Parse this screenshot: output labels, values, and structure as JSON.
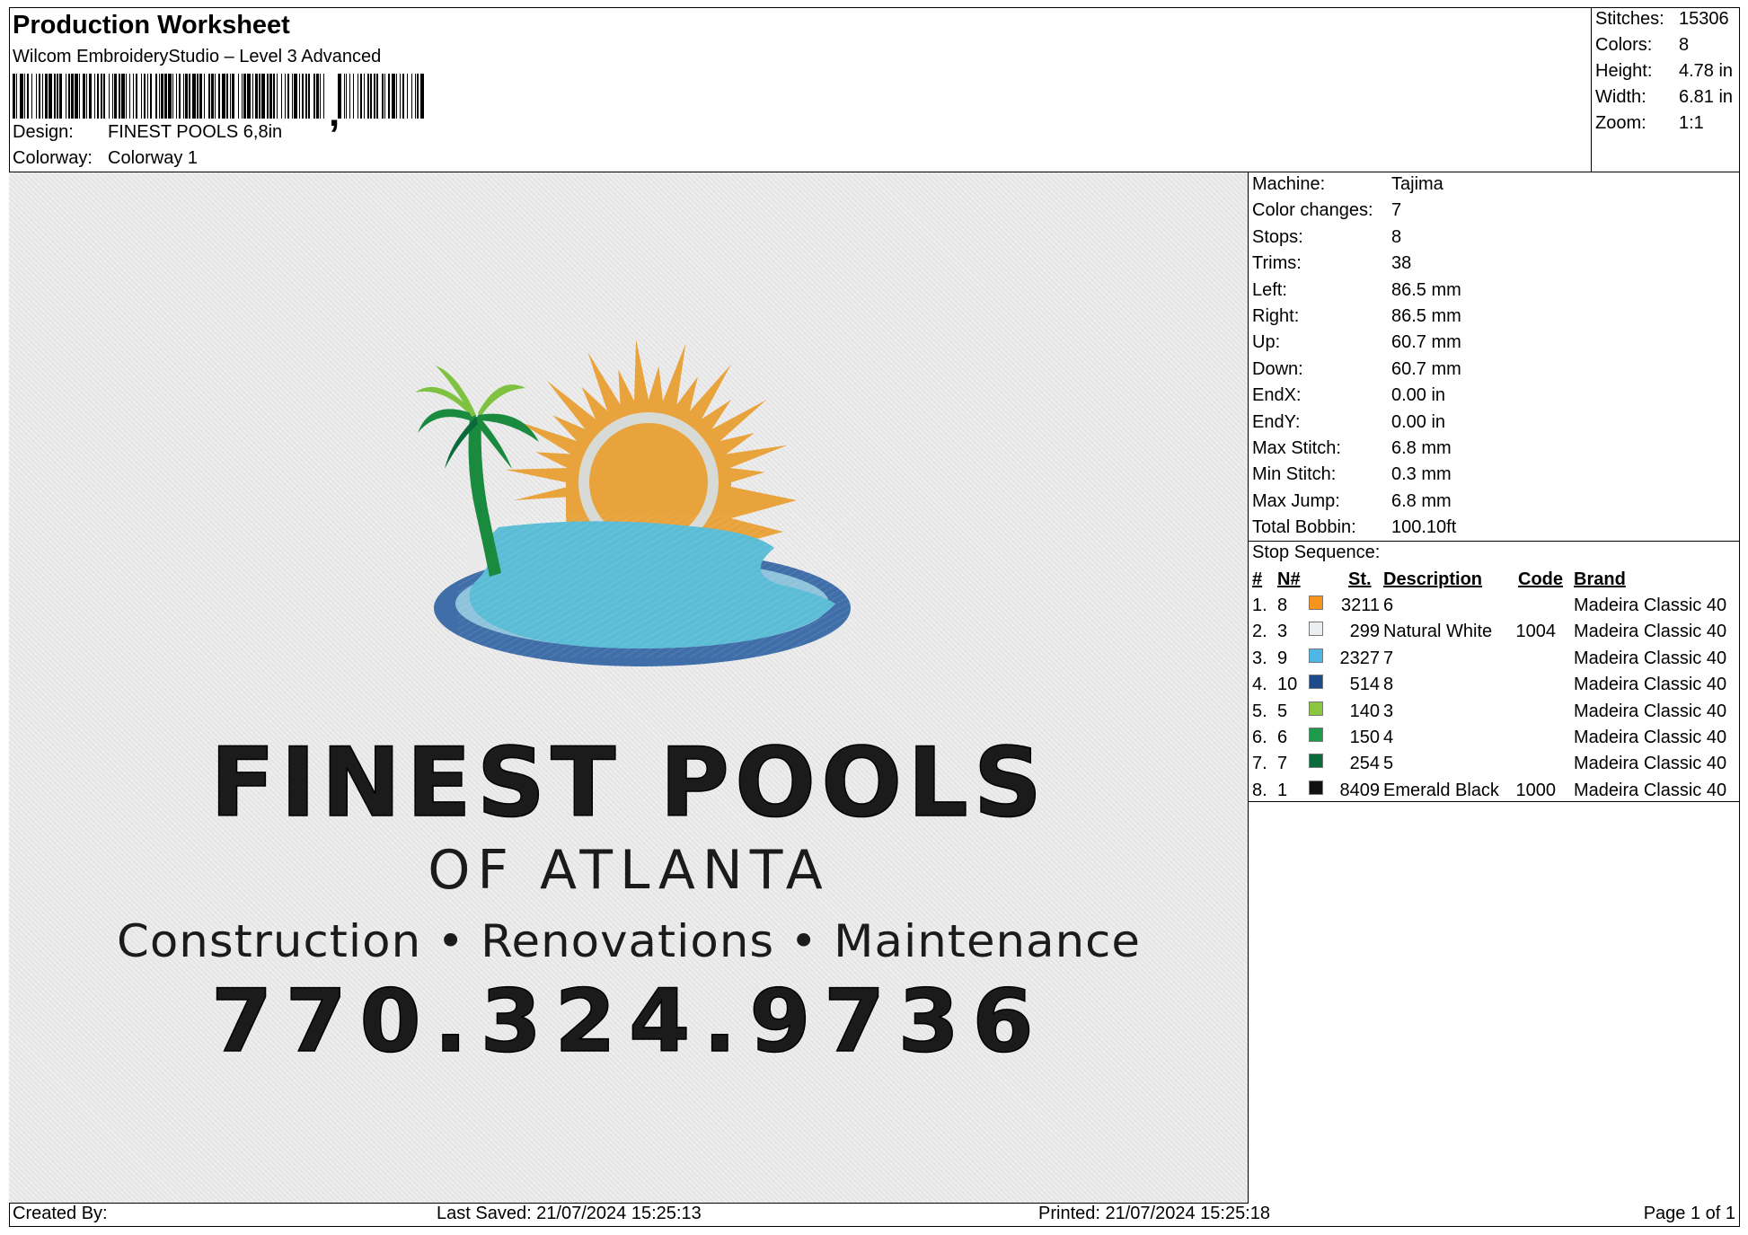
{
  "header": {
    "title": "Production Worksheet",
    "subtitle": "Wilcom EmbroideryStudio – Level 3 Advanced",
    "barcode_comma": ",",
    "design_label": "Design:",
    "design_value": "FINEST POOLS 6,8in",
    "colorway_label": "Colorway:",
    "colorway_value": "Colorway 1"
  },
  "stats": [
    {
      "label": "Stitches:",
      "value": "15306"
    },
    {
      "label": "Colors:",
      "value": "8"
    },
    {
      "label": "Height:",
      "value": "4.78 in"
    },
    {
      "label": "Width:",
      "value": "6.81 in"
    },
    {
      "label": "Zoom:",
      "value": "1:1"
    }
  ],
  "machine_info": [
    {
      "label": "Machine:",
      "value": "Tajima"
    },
    {
      "label": "Color changes:",
      "value": "7"
    },
    {
      "label": "Stops:",
      "value": "8"
    },
    {
      "label": "Trims:",
      "value": "38"
    },
    {
      "label": "Left:",
      "value": "86.5 mm"
    },
    {
      "label": "Right:",
      "value": "86.5 mm"
    },
    {
      "label": "Up:",
      "value": "60.7 mm"
    },
    {
      "label": "Down:",
      "value": "60.7 mm"
    },
    {
      "label": "EndX:",
      "value": "0.00 in"
    },
    {
      "label": "EndY:",
      "value": "0.00 in"
    },
    {
      "label": "Max Stitch:",
      "value": "6.8 mm"
    },
    {
      "label": "Min Stitch:",
      "value": "0.3 mm"
    },
    {
      "label": "Max Jump:",
      "value": "6.8 mm"
    },
    {
      "label": "Total Bobbin:",
      "value": "100.10ft"
    }
  ],
  "stop_sequence": {
    "title": "Stop Sequence:",
    "headers": {
      "idx": "#",
      "n": "N#",
      "st": "St.",
      "desc": "Description",
      "code": "Code",
      "brand": "Brand"
    },
    "rows": [
      {
        "idx": "1.",
        "n": "8",
        "color": "#f7941d",
        "st": "3211",
        "desc": "6",
        "code": "",
        "brand": "Madeira Classic 40"
      },
      {
        "idx": "2.",
        "n": "3",
        "color": "#eceeef",
        "st": "299",
        "desc": "Natural White",
        "code": "1004",
        "brand": "Madeira Classic 40"
      },
      {
        "idx": "3.",
        "n": "9",
        "color": "#4fb6e6",
        "st": "2327",
        "desc": "7",
        "code": "",
        "brand": "Madeira Classic 40"
      },
      {
        "idx": "4.",
        "n": "10",
        "color": "#1f4a8a",
        "st": "514",
        "desc": "8",
        "code": "",
        "brand": "Madeira Classic 40"
      },
      {
        "idx": "5.",
        "n": "5",
        "color": "#8cc63f",
        "st": "140",
        "desc": "3",
        "code": "",
        "brand": "Madeira Classic 40"
      },
      {
        "idx": "6.",
        "n": "6",
        "color": "#1e9b4a",
        "st": "150",
        "desc": "4",
        "code": "",
        "brand": "Madeira Classic 40"
      },
      {
        "idx": "7.",
        "n": "7",
        "color": "#0b6a3a",
        "st": "254",
        "desc": "5",
        "code": "",
        "brand": "Madeira Classic 40"
      },
      {
        "idx": "8.",
        "n": "1",
        "color": "#111111",
        "st": "8409",
        "desc": "Emerald Black",
        "code": "1000",
        "brand": "Madeira Classic 40"
      }
    ]
  },
  "design_text": {
    "line1": "FINEST POOLS",
    "line2": "OF ATLANTA",
    "line3": "Construction • Renovations • Maintenance",
    "line4": "770.324.9736"
  },
  "footer": {
    "created": "Created By:",
    "saved": "Last Saved: 21/07/2024 15:25:13",
    "printed": "Printed: 21/07/2024 15:25:18",
    "page": "Page 1 of 1"
  },
  "colors": {
    "sun": "#e9a33c",
    "ring": "#d8dad6",
    "water": "#5bbcd6",
    "pool_rim": "#3f6ea8",
    "palm_light": "#7fc241",
    "palm_dark": "#1a8a3e",
    "thread_black": "#1b1b1b"
  }
}
